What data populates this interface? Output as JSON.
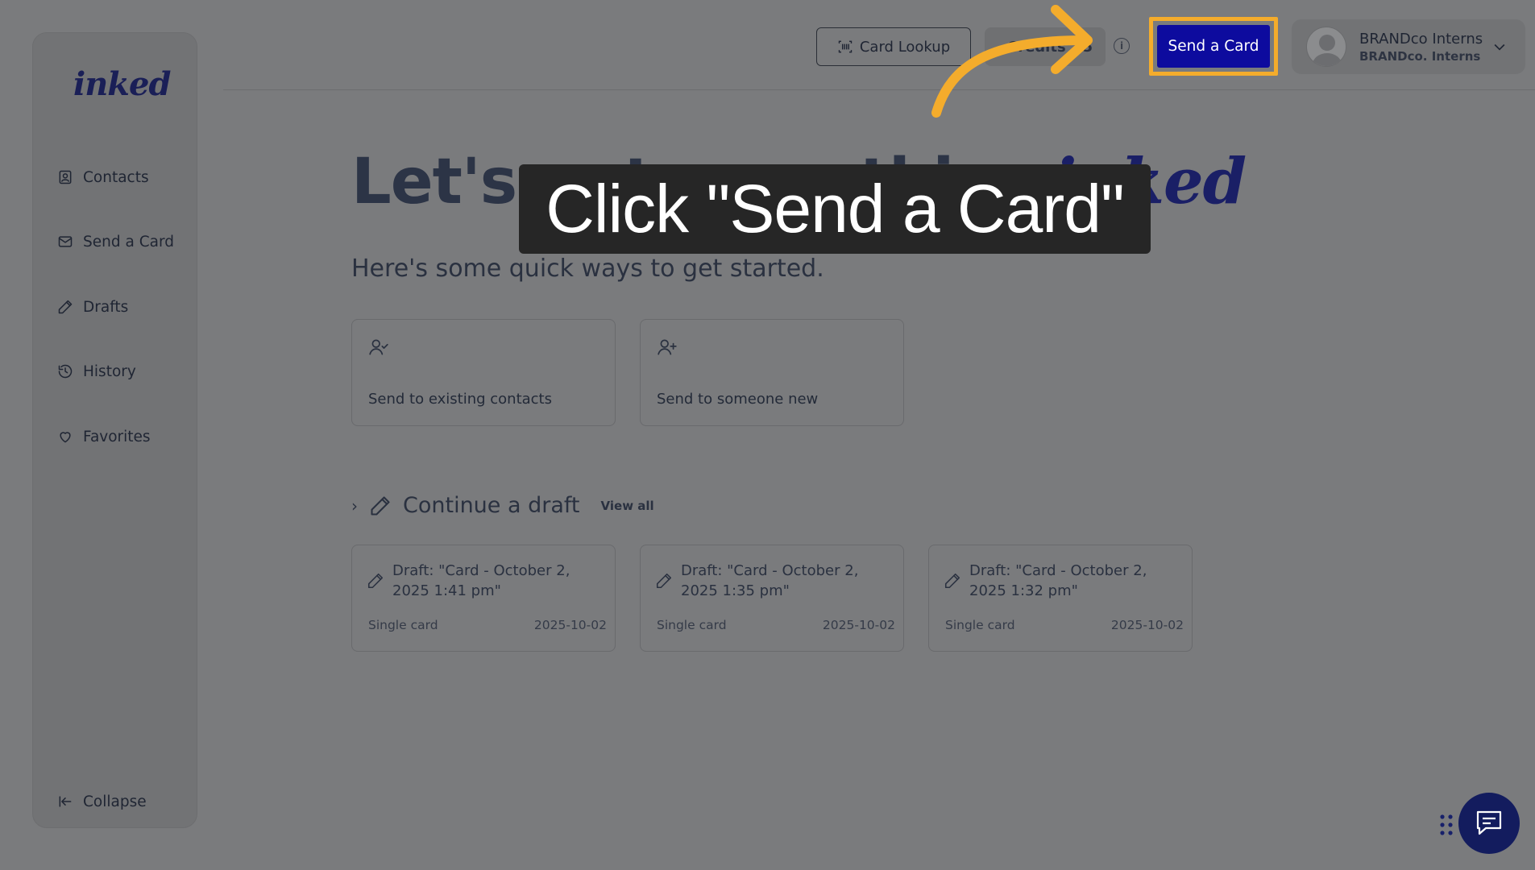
{
  "brand": {
    "logo_text": "inked"
  },
  "sidebar": {
    "items": [
      {
        "label": "Contacts",
        "icon": "contacts-icon"
      },
      {
        "label": "Send a Card",
        "icon": "mail-icon"
      },
      {
        "label": "Drafts",
        "icon": "pencil-icon"
      },
      {
        "label": "History",
        "icon": "history-icon"
      },
      {
        "label": "Favorites",
        "icon": "heart-icon"
      }
    ],
    "collapse_label": "Collapse"
  },
  "topbar": {
    "card_lookup_label": "Card Lookup",
    "credits_label": "Credits",
    "credits_value": "5",
    "send_card_label": "Send a Card",
    "user_name": "BRANDco Interns",
    "user_org": "BRANDco. Interns"
  },
  "main": {
    "hero_title": "Let's get something",
    "hero_title_brand": "inked",
    "hero_subtitle": "Here's some quick ways to get started.",
    "quick_actions": [
      {
        "label": "Send to existing contacts",
        "icon": "user-check-icon"
      },
      {
        "label": "Send to someone new",
        "icon": "user-plus-icon"
      }
    ],
    "drafts_heading": "Continue a draft",
    "drafts_view_all": "View all",
    "drafts": [
      {
        "title": "Draft: \"Card - October 2, 2025 1:41 pm\"",
        "type": "Single card",
        "date": "2025-10-02"
      },
      {
        "title": "Draft: \"Card - October 2, 2025 1:35 pm\"",
        "type": "Single card",
        "date": "2025-10-02"
      },
      {
        "title": "Draft: \"Card - October 2, 2025 1:32 pm\"",
        "type": "Single card",
        "date": "2025-10-02"
      }
    ]
  },
  "tutorial": {
    "callout_text": "Click \"Send a Card\"",
    "highlight_color": "#f4ac2c"
  },
  "colors": {
    "accent": "#0d0b9e",
    "brand_dark": "#1a1f57",
    "chat_bg": "#131c5e"
  }
}
